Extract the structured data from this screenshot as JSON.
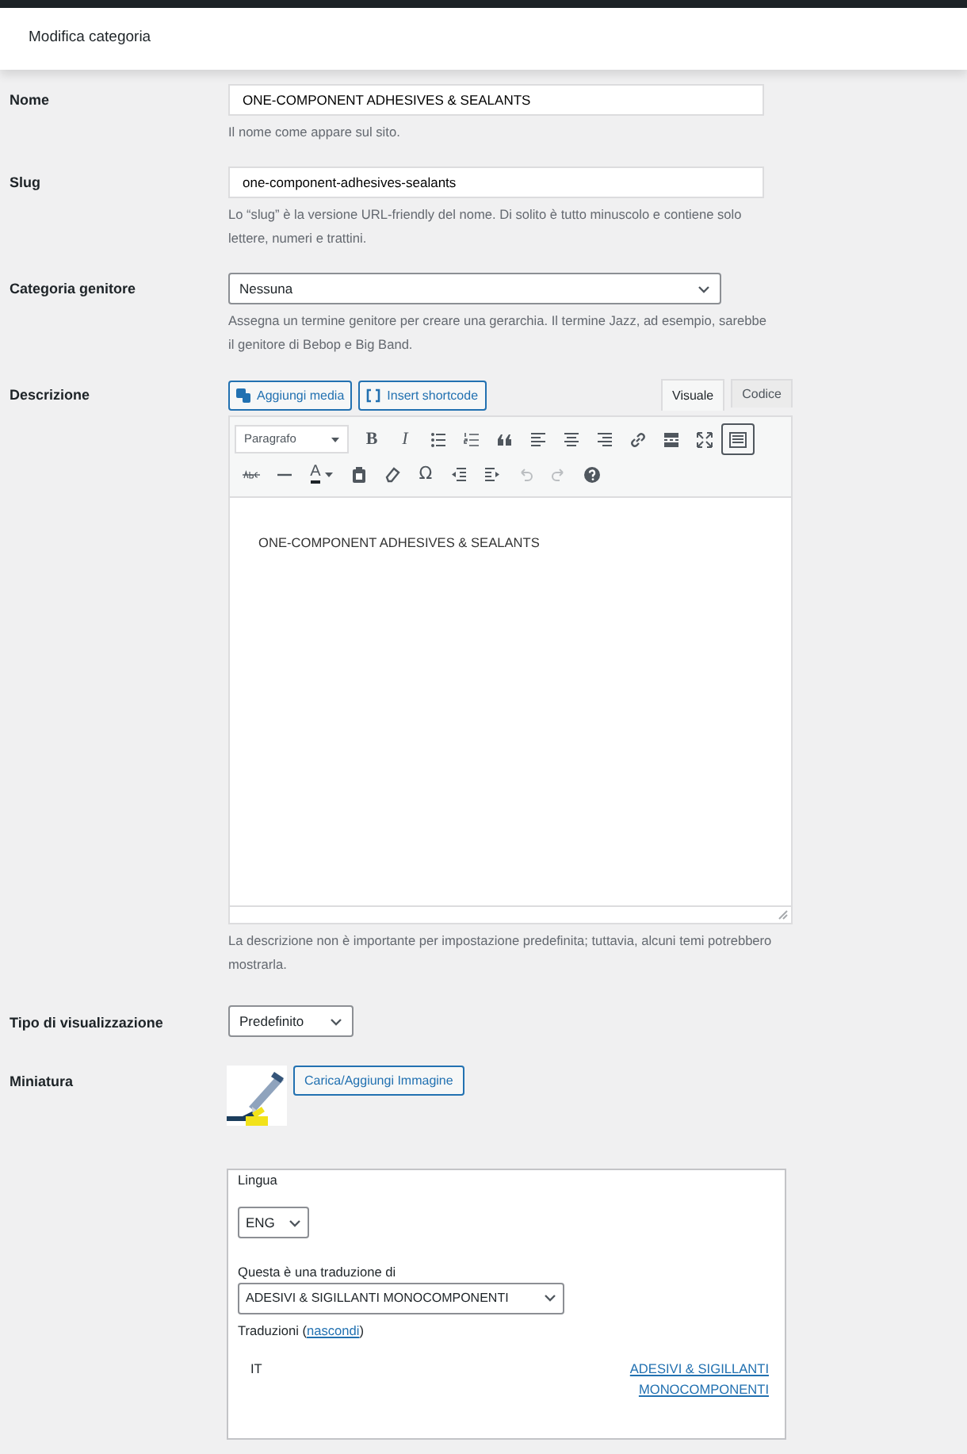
{
  "header": {
    "title": "Modifica categoria"
  },
  "fields": [
    {
      "kind": "text",
      "label": "Nome",
      "value": "ONE-COMPONENT ADHESIVES & SEALANTS",
      "help": "Il nome come appare sul sito."
    },
    {
      "kind": "text",
      "label": "Slug",
      "value": "one-component-adhesives-sealants",
      "help": "Lo “slug” è la versione URL-friendly del nome. Di solito è tutto minuscolo e contiene solo lettere, numeri e trattini."
    },
    {
      "kind": "select",
      "label": "Categoria genitore",
      "value": "Nessuna",
      "help": "Assegna un termine genitore per creare una gerarchia. Il termine Jazz, ad esempio, sarebbe il genitore di Bebop e Big Band."
    }
  ],
  "description": {
    "label": "Descrizione",
    "media_buttons": [
      {
        "kind": "media",
        "label": "Aggiungi media"
      },
      {
        "kind": "shortcode",
        "label": "Insert shortcode"
      }
    ],
    "tabs": [
      {
        "label": "Visuale",
        "selected": true
      },
      {
        "label": "Codice",
        "selected": false
      }
    ],
    "format": "Paragrafo",
    "toolbar": [
      [
        {
          "kind": "bold",
          "text": "B"
        },
        {
          "kind": "italic",
          "text": "I"
        },
        {
          "kind": "bullets"
        },
        {
          "kind": "numbers"
        },
        {
          "kind": "quote"
        },
        {
          "kind": "align-left"
        },
        {
          "kind": "align-center"
        },
        {
          "kind": "align-right"
        },
        {
          "kind": "link"
        },
        {
          "kind": "more"
        },
        {
          "kind": "fullscreen"
        },
        {
          "kind": "toolbar",
          "selected": true
        }
      ],
      [
        {
          "kind": "strike"
        },
        {
          "kind": "hr"
        },
        {
          "kind": "color",
          "text": "A"
        },
        {
          "kind": "paste"
        },
        {
          "kind": "eraser"
        },
        {
          "kind": "symbol",
          "text": "Ω"
        },
        {
          "kind": "outdent"
        },
        {
          "kind": "indent"
        },
        {
          "kind": "undo",
          "disabled": true
        },
        {
          "kind": "redo",
          "disabled": true
        },
        {
          "kind": "help"
        }
      ]
    ],
    "content": "ONE-COMPONENT ADHESIVES & SEALANTS",
    "help": "La descrizione non è importante per impostazione predefinita; tuttavia, alcuni temi potrebbero mostrarla."
  },
  "display": {
    "label": "Tipo di visualizzazione",
    "value": "Predefinito"
  },
  "thumbnail": {
    "label": "Miniatura",
    "kind": "picture",
    "button": "Carica/Aggiungi Immagine"
  },
  "language": {
    "label": "Lingua",
    "value": "ENG",
    "translation_label": "Questa è una traduzione di",
    "translation_value": "ADESIVI & SIGILLANTI MONOCOMPONENTI",
    "translations_label": "Traduzioni",
    "toggle_open": "(",
    "toggle": "nascondi",
    "toggle_close": ")",
    "rows": [
      {
        "code": "IT",
        "title": "ADESIVI & SIGILLANTI MONOCOMPONENTI"
      }
    ]
  }
}
